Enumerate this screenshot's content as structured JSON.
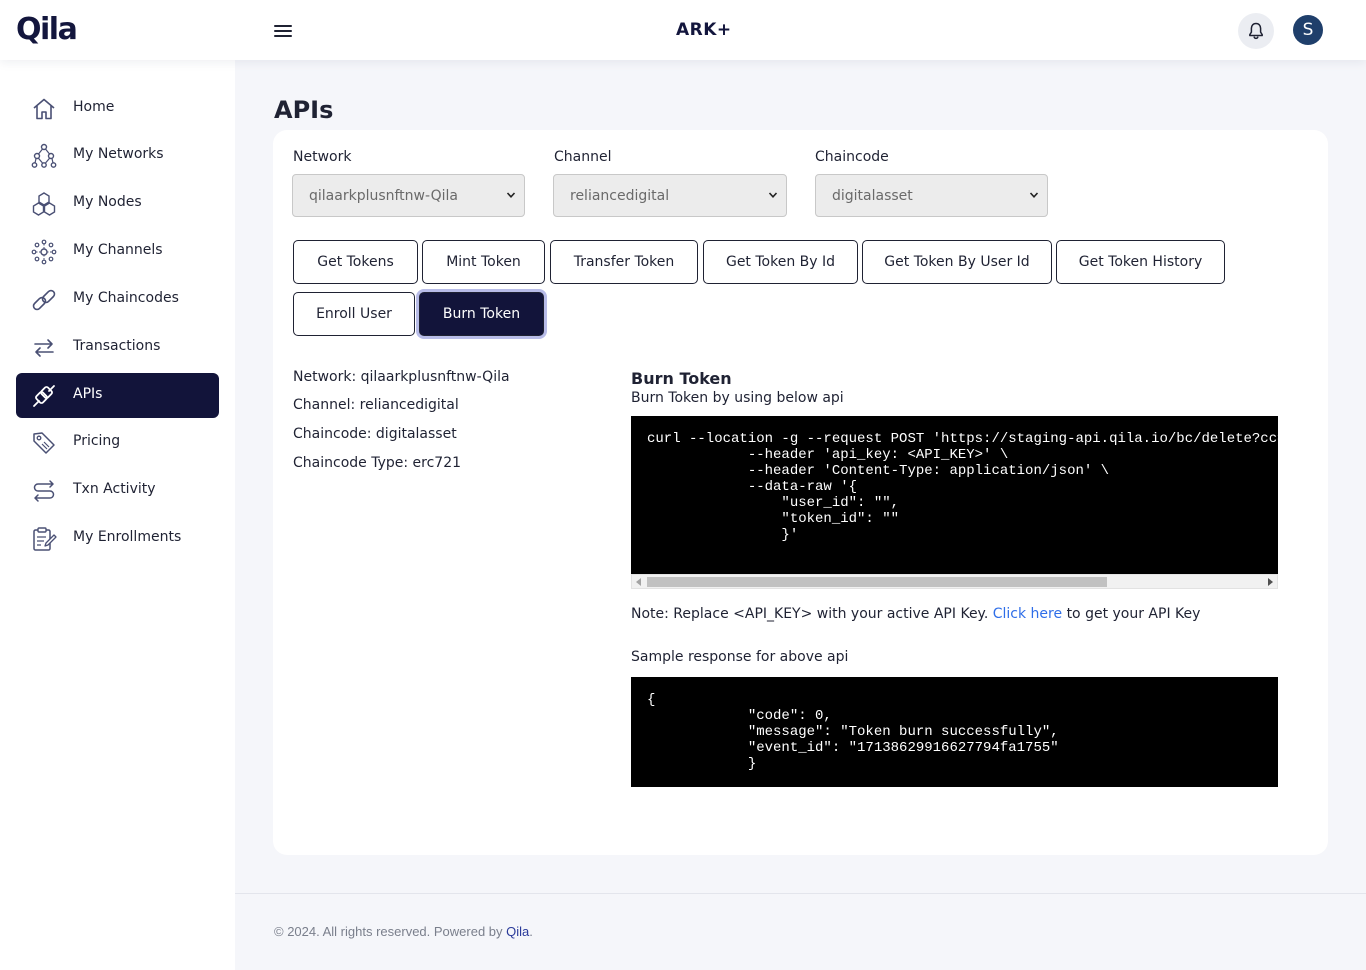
{
  "header": {
    "logo": "Qila",
    "brand": "ARK+",
    "avatar_initial": "S"
  },
  "sidebar": {
    "items": [
      {
        "label": "Home",
        "icon": "home-icon"
      },
      {
        "label": "My Networks",
        "icon": "network-icon"
      },
      {
        "label": "My Nodes",
        "icon": "nodes-icon"
      },
      {
        "label": "My Channels",
        "icon": "channels-icon"
      },
      {
        "label": "My Chaincodes",
        "icon": "chain-link-icon"
      },
      {
        "label": "Transactions",
        "icon": "transfer-arrows-icon"
      },
      {
        "label": "APIs",
        "icon": "plug-icon",
        "active": true
      },
      {
        "label": "Pricing",
        "icon": "price-tag-icon"
      },
      {
        "label": "Txn Activity",
        "icon": "activity-icon"
      },
      {
        "label": "My Enrollments",
        "icon": "clipboard-icon"
      }
    ]
  },
  "page": {
    "title": "APIs"
  },
  "filters": {
    "network": {
      "label": "Network",
      "value": "qilaarkplusnftnw-Qila"
    },
    "channel": {
      "label": "Channel",
      "value": "reliancedigital"
    },
    "chaincode": {
      "label": "Chaincode",
      "value": "digitalasset"
    }
  },
  "api_buttons": [
    {
      "label": "Get Tokens"
    },
    {
      "label": "Mint Token"
    },
    {
      "label": "Transfer Token"
    },
    {
      "label": "Get Token By Id"
    },
    {
      "label": "Get Token By User Id"
    },
    {
      "label": "Get Token History"
    },
    {
      "label": "Enroll User"
    },
    {
      "label": "Burn Token",
      "active": true
    }
  ],
  "info": {
    "network": "Network: qilaarkplusnftnw-Qila",
    "channel": "Channel: reliancedigital",
    "chaincode": "Chaincode: digitalasset",
    "chaincode_type": "Chaincode Type: erc721"
  },
  "api": {
    "title": "Burn Token",
    "description": "Burn Token by using below api",
    "request_code": "curl --location -g --request POST 'https://staging-api.qila.io/bc/delete?cc=digitalasset' \\\n            --header 'api_key: <API_KEY>' \\\n            --header 'Content-Type: application/json' \\\n            --data-raw '{\n                \"user_id\": \"\",\n                \"token_id\": \"\"\n                }'",
    "note_prefix": "Note: Replace <API_KEY> with your active API Key.",
    "note_link": "Click here",
    "note_suffix": "to get your API Key",
    "sample_label": "Sample response for above api",
    "response_code": "{\n            \"code\": 0,\n            \"message\": \"Token burn successfully\",\n            \"event_id\": \"17138629916627794fa1755\"\n            }"
  },
  "footer": {
    "text": "© 2024. All rights reserved. Powered by",
    "link": "Qila",
    "end": "."
  },
  "colors": {
    "primary": "#12143a",
    "link": "#2f6ee8",
    "code_bg": "#000000"
  }
}
